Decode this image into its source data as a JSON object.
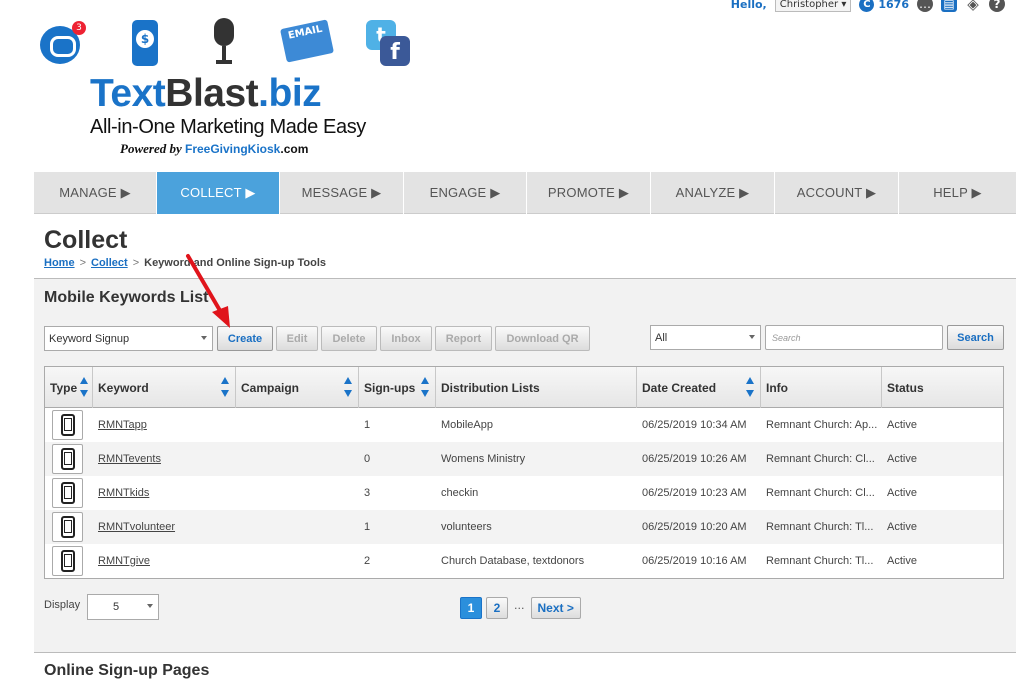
{
  "userbar": {
    "hello": "Hello,",
    "user_name": "Christopher",
    "credits_icon": "C",
    "credits": "1676",
    "icons": [
      "chat-bubble-icon",
      "print-icon",
      "layers-icon",
      "help-icon"
    ]
  },
  "logo": {
    "chat_badge": "3",
    "email_label": "EMAIL",
    "twitter_glyph": "t",
    "facebook_glyph": "f",
    "brand_part1": "Text",
    "brand_part2": "Blast",
    "brand_part3": ".biz",
    "tagline": "All-in-One Marketing Made Easy",
    "powered_by": "Powered by ",
    "powered_kiosk1": "FreeGivingKiosk",
    "powered_kiosk2": ".com"
  },
  "nav": [
    {
      "label": "MANAGE ▶",
      "active": false
    },
    {
      "label": "COLLECT ▶",
      "active": true
    },
    {
      "label": "MESSAGE ▶",
      "active": false
    },
    {
      "label": "ENGAGE ▶",
      "active": false
    },
    {
      "label": "PROMOTE ▶",
      "active": false
    },
    {
      "label": "ANALYZE ▶",
      "active": false
    },
    {
      "label": "ACCOUNT ▶",
      "active": false
    },
    {
      "label": "HELP ▶",
      "active": false
    }
  ],
  "page": {
    "title": "Collect",
    "breadcrumb": {
      "home": "Home",
      "sep": ">",
      "collect": "Collect",
      "current": "Keyword and Online Sign-up Tools"
    }
  },
  "keywords_panel": {
    "title": "Mobile Keywords List",
    "type_select": "Keyword Signup",
    "buttons": {
      "create": "Create",
      "edit": "Edit",
      "delete": "Delete",
      "inbox": "Inbox",
      "report": "Report",
      "download_qr": "Download QR"
    },
    "filter_select": "All",
    "search_placeholder": "Search",
    "search_button": "Search"
  },
  "table": {
    "columns": [
      "Type",
      "Keyword",
      "Campaign",
      "Sign-ups",
      "Distribution Lists",
      "Date Created",
      "Info",
      "Status"
    ],
    "rows": [
      {
        "keyword": "RMNTapp",
        "campaign": "",
        "signups": "1",
        "lists": "MobileApp",
        "date": "06/25/2019 10:34 AM",
        "info": "Remnant Church: Ap...",
        "status": "Active"
      },
      {
        "keyword": "RMNTevents",
        "campaign": "",
        "signups": "0",
        "lists": "Womens Ministry",
        "date": "06/25/2019 10:26 AM",
        "info": "Remnant Church: Cl...",
        "status": "Active"
      },
      {
        "keyword": "RMNTkids",
        "campaign": "",
        "signups": "3",
        "lists": "checkin",
        "date": "06/25/2019 10:23 AM",
        "info": "Remnant Church: Cl...",
        "status": "Active"
      },
      {
        "keyword": "RMNTvolunteer",
        "campaign": "",
        "signups": "1",
        "lists": "volunteers",
        "date": "06/25/2019 10:20 AM",
        "info": "Remnant Church: Tl...",
        "status": "Active"
      },
      {
        "keyword": "RMNTgive",
        "campaign": "",
        "signups": "2",
        "lists": "Church Database, textdonors",
        "date": "06/25/2019 10:16 AM",
        "info": "Remnant Church: Tl...",
        "status": "Active"
      }
    ]
  },
  "footer": {
    "display_label": "Display",
    "display_value": "5",
    "pages": [
      "1",
      "2"
    ],
    "ellipsis": "···",
    "next": "Next >"
  },
  "section2_title": "Online Sign-up Pages",
  "colors": {
    "accent": "#1a73c8",
    "nav_active": "#4ba2dc",
    "annotation_arrow": "#e0141b"
  }
}
